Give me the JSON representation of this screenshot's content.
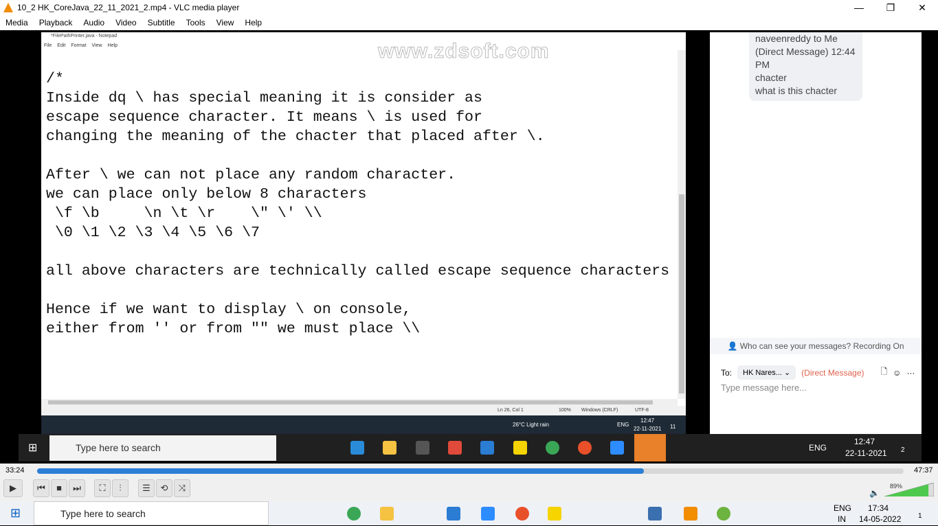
{
  "window": {
    "title": "10_2 HK_CoreJava_22_11_2021_2.mp4 - VLC media player",
    "min": "—",
    "max": "❐",
    "close": "✕"
  },
  "menu": [
    "Media",
    "Playback",
    "Audio",
    "Video",
    "Subtitle",
    "Tools",
    "View",
    "Help"
  ],
  "notepad": {
    "title": "*FilePathPrinter.java - Notepad",
    "menu": [
      "File",
      "Edit",
      "Format",
      "View",
      "Help"
    ],
    "lines": [
      "/*",
      "Inside dq \\ has special meaning it is consider as",
      "escape sequence character. It means \\ is used for",
      "changing the meaning of the chacter that placed after \\.",
      "",
      "After \\ we can not place any random character.",
      "we can place only below 8 characters",
      " \\f \\b     \\n \\t \\r    \\\" \\' \\\\",
      " \\0 \\1 \\2 \\3 \\4 \\5 \\6 \\7",
      "",
      "all above characters are technically called escape sequence characters",
      "",
      "Hence if we want to display \\ on console,",
      "either from '' or from \"\" we must place \\\\"
    ],
    "status": {
      "pos": "Ln 26, Col 1",
      "zoom": "100%",
      "eol": "Windows (CRLF)",
      "enc": "UTF-8"
    }
  },
  "watermark": "www.zdsoft.com",
  "inner_taskbar": {
    "weather": "26°C  Light rain",
    "lang": "ENG",
    "time": "12:47",
    "date": "22-11-2021",
    "notif": "11"
  },
  "zoom_chat": {
    "message_lines": [
      "naveenreddy to Me",
      "(Direct Message) 12:44",
      "PM",
      "chacter",
      "what is this chacter"
    ],
    "notice": "Who can see your messages? Recording On",
    "to_label": "To:",
    "recipient": "HK Nares...",
    "dm": "(Direct Message)",
    "placeholder": "Type message here..."
  },
  "video_taskbar": {
    "search": "Type here to search",
    "lang": "ENG",
    "time": "12:47",
    "date": "22-11-2021",
    "notif": "2"
  },
  "player": {
    "elapsed": "33:24",
    "total": "47:37",
    "progress": 0.7,
    "volume": "89%",
    "volume_level": 0.89
  },
  "taskbar": {
    "search": "Type here to search",
    "lang": "ENG",
    "region": "IN",
    "time": "17:34",
    "date": "14-05-2022",
    "notif": "1"
  }
}
